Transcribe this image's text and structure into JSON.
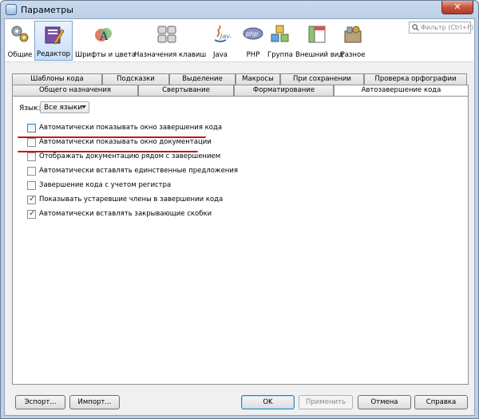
{
  "window": {
    "title": "Параметры",
    "close_glyph": "✕"
  },
  "search": {
    "placeholder": "Фильтр (Ctrl+F)"
  },
  "categories": [
    {
      "label": "Общие",
      "icon": "gears-icon"
    },
    {
      "label": "Редактор",
      "icon": "editor-icon",
      "selected": true
    },
    {
      "label": "Шрифты и цвета",
      "icon": "fonts-colors-icon"
    },
    {
      "label": "Назначения клавиш",
      "icon": "keyboard-icon"
    },
    {
      "label": "Java",
      "icon": "java-icon"
    },
    {
      "label": "PHP",
      "icon": "php-icon"
    },
    {
      "label": "Группа",
      "icon": "group-icon"
    },
    {
      "label": "Внешний вид",
      "icon": "appearance-icon"
    },
    {
      "label": "Разное",
      "icon": "misc-icon"
    }
  ],
  "tabs_back": [
    "Шаблоны кода",
    "Подсказки",
    "Выделение",
    "Макросы",
    "При сохранении",
    "Проверка орфографии"
  ],
  "tabs_front": [
    "Общего назначения",
    "Свертывание",
    "Форматирование",
    "Автозавершение кода"
  ],
  "active_tab": "Автозавершение кода",
  "language": {
    "label": "Язык:",
    "value": "Все языки"
  },
  "options": [
    {
      "label": "Автоматически показывать окно завершения кода",
      "checked": false
    },
    {
      "label": "Автоматически показывать окно документации",
      "checked": false
    },
    {
      "label": "Отображать документацию рядом с завершением",
      "checked": false
    },
    {
      "label": "Автоматически вставлять единственные предложения",
      "checked": false
    },
    {
      "label": "Завершение кода с учетом регистра",
      "checked": false
    },
    {
      "label": "Показывать устаревшие члены в завершении кода",
      "checked": true
    },
    {
      "label": "Автоматически вставлять закрывающие скобки",
      "checked": true
    }
  ],
  "buttons": {
    "export": "Эспорт...",
    "import": "Импорт...",
    "ok": "OK",
    "apply": "Применить",
    "cancel": "Отмена",
    "help": "Справка"
  },
  "colors": {
    "annotation_red": "#c8161b",
    "selection_blue": "#c7def7"
  }
}
